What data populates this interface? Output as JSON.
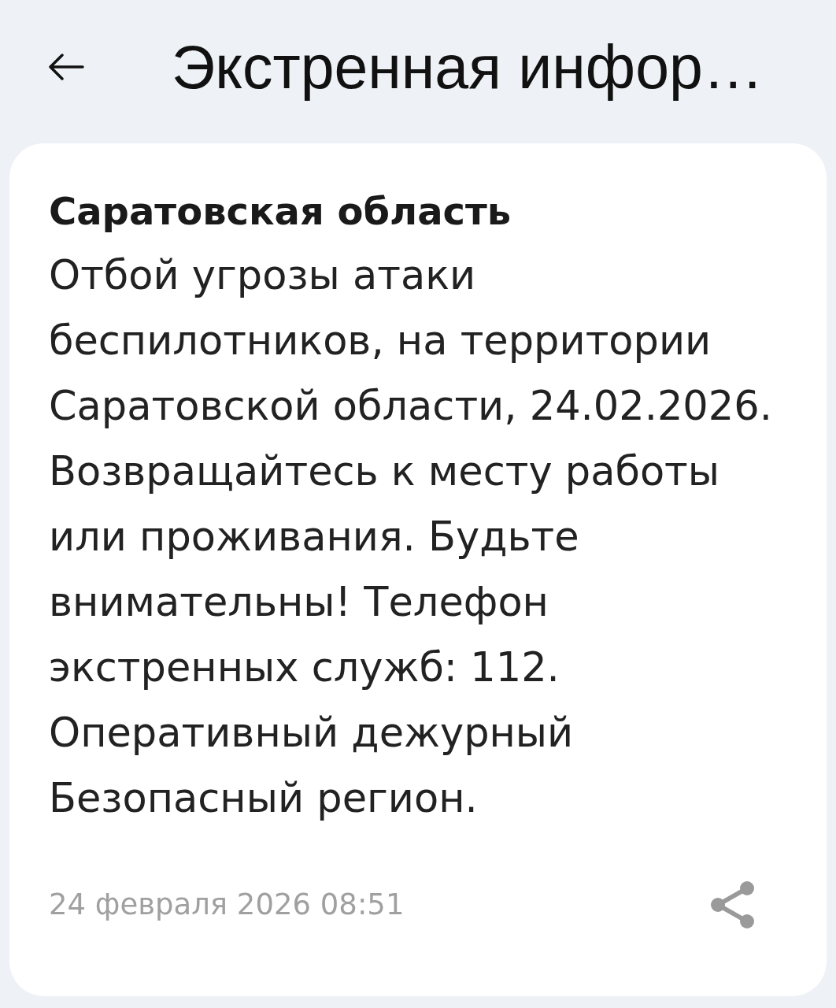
{
  "header": {
    "title": "Экстренная инфор…"
  },
  "message": {
    "region": "Саратовская область",
    "text": "Отбой угрозы атаки\nбеспилотников, на территории\nСаратовской области, 24.02.2026.\nВозвращайтесь к месту работы\nили проживания. Будьте\nвнимательны! Телефон\nэкстренных служб: 112.\nОперативный дежурный\nБезопасный регион.",
    "date": "24 февраля 2026 08:51"
  }
}
